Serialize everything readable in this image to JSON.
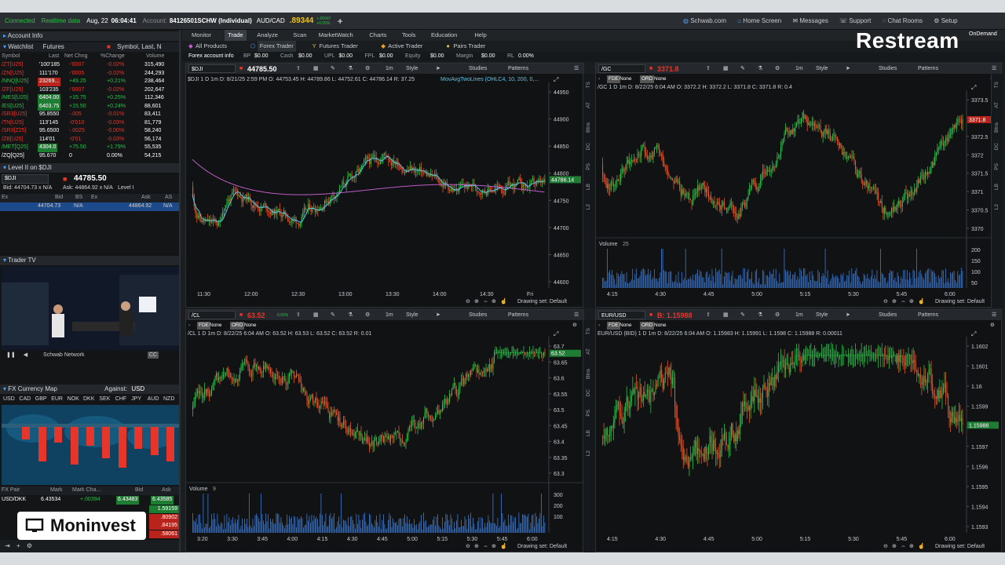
{
  "status": {
    "connection": "Connected",
    "realtime": "Realtime data",
    "date": "Aug, 22",
    "time": "06:04:41",
    "account_label": "Account:",
    "account": "84126501SCHW (Individual)",
    "pair": "AUD/CAD",
    "pair_price": ".89344",
    "pair_chg_top": "+.00047",
    "pair_chg_bot": "+0.05%"
  },
  "top_links": [
    "Schwab.com",
    "Home Screen",
    "Messages",
    "Support",
    "Chat Rooms",
    "Setup"
  ],
  "nav_tabs": [
    "Monitor",
    "Trade",
    "Analyze",
    "Scan",
    "MarketWatch",
    "Charts",
    "Tools",
    "Education",
    "Help"
  ],
  "sub_tabs": [
    "All Products",
    "Forex Trader",
    "Futures Trader",
    "Active Trader",
    "Pairs Trader"
  ],
  "forex_bar": {
    "label": "Forex account info",
    "items": [
      [
        "BP",
        "$0.00"
      ],
      [
        "Cash",
        "$0.00"
      ],
      [
        "UPL",
        "$0.00"
      ],
      [
        "FPL",
        "$0.00"
      ],
      [
        "Equity",
        "$0.00"
      ],
      [
        "Margin",
        "$0.00"
      ],
      [
        "RL",
        "0.00%"
      ]
    ]
  },
  "left": {
    "account_info": "Account Info",
    "watchlist": "Watchlist",
    "watchlist_name": "Futures",
    "symbol_search": "Symbol, Last, N",
    "wl_headers": [
      "Symbol",
      "Last",
      "Net Chng",
      "%Change",
      "Volume"
    ],
    "wl_rows": [
      [
        "/ZT[U25]",
        "'100'185",
        "-'0007",
        "-0.02%",
        "315,490"
      ],
      [
        "/ZN[U25]",
        "111'170",
        "-'0005",
        "-0.02%",
        "244,293"
      ],
      [
        "/NNQ[U25]",
        "23269...",
        "+49.25",
        "+0.21%",
        "238,464"
      ],
      [
        "/ZF[U25]",
        "103'235",
        "-'0007",
        "-0.02%",
        "202,647"
      ],
      [
        "/MES[U25]",
        "6404.00",
        "+15.75",
        "+0.25%",
        "112,346"
      ],
      [
        "/ES[U25]",
        "6403.75",
        "+15.50",
        "+0.24%",
        "88,601"
      ],
      [
        "/SR3[U25]",
        "95.8550",
        "-.005",
        "-0.01%",
        "83,411"
      ],
      [
        "/TN[U25]",
        "113'145",
        "-0'010",
        "-0.03%",
        "81,779"
      ],
      [
        "/SR3[Z25]",
        "95.6500",
        "-.0025",
        "-0.00%",
        "58,240"
      ],
      [
        "/ZB[U25]",
        "114'01",
        "-0'01",
        "-0.03%",
        "56,174"
      ],
      [
        "/MET[Q25]",
        "4304.0",
        "+75.50",
        "+1.79%",
        "55,535"
      ],
      [
        "/ZQ[Q25]",
        "95.670",
        "0",
        "0.00%",
        "54,215"
      ]
    ],
    "level2_title": "Level II on $DJI",
    "l2_symbol": "$DJI",
    "l2_price": "44785.50",
    "l2_bid": "Bid: 44704.73 x N/A",
    "l2_ask": "Ask: 44864.92 x N/A",
    "l2_level": "Level I",
    "l2_headers": [
      "Ex",
      "Bid",
      "BS",
      "Ex",
      "Ask",
      "AS"
    ],
    "l2_row": [
      "",
      "44704.73",
      "N/A",
      "",
      "44864.92",
      "N/A"
    ],
    "trader_tv": "Trader TV",
    "tv_network": "Schwab Network",
    "tv_cc": "CC",
    "fx_map": "FX Currency Map",
    "against_label": "Against:",
    "against": "USD",
    "currencies": [
      "USD",
      "CAD",
      "GBP",
      "EUR",
      "NOK",
      "DKK",
      "SEK",
      "CHF",
      "JPY",
      "AUD",
      "NZD"
    ],
    "fx_headers": [
      "FX Pair",
      "Mark",
      "Mark Cha...",
      "Bid",
      "Ask"
    ],
    "fx_row": [
      "USD/DKK",
      "6.43534",
      "+.00394",
      "6.43483",
      "6.43585"
    ],
    "fx_side": [
      "1.59159",
      ".80902",
      ".84195",
      ".58061"
    ]
  },
  "panes": {
    "dji": {
      "symbol": "$DJI",
      "price": "44785.50",
      "info": "$DJI 1 D 1m  D: 8/21/25 2:59 PM  O: 44753.45  H: 44789.86  L: 44752.61  C: 44786.14  R: 37.25",
      "study": "MovAvgTwoLines (OHLC4, 10, 200, 0,...",
      "last_tag": "44786.14",
      "y_ticks": [
        "44950",
        "44900",
        "44850",
        "44800",
        "44750",
        "44700",
        "44650",
        "44600"
      ],
      "x_ticks": [
        "11:30",
        "12:00",
        "12:30",
        "13:00",
        "13:30",
        "14:00",
        "14:30",
        "Fri"
      ],
      "drawing_set": "Drawing set: Default"
    },
    "gc": {
      "symbol": "/GC",
      "price": "3371.8",
      "info": "/GC 1 D 1m  D: 8/22/25 6:04 AM  O: 3372.2  H: 3372.2  L: 3371.8  C: 3371.8  R: 0.4",
      "last_tag": "3371.8",
      "y_ticks": [
        "3373.5",
        "3373",
        "3372.5",
        "3372",
        "3371.5",
        "3371",
        "3370.5",
        "3370"
      ],
      "volume_label": "Volume",
      "volume_val": "25",
      "vol_ticks": [
        "200",
        "150",
        "100",
        "50"
      ],
      "x_ticks": [
        "4:15",
        "4:30",
        "4:45",
        "5:00",
        "5:15",
        "5:30",
        "5:45",
        "6:00"
      ],
      "drawing_set": "Drawing set: Default"
    },
    "cl": {
      "symbol": "/CL",
      "price": "63.52",
      "chg": "0.00%",
      "info": "/CL 1 D 1m  D: 8/22/25 6:04 AM  O: 63.52  H: 63.53  L: 63.52  C: 63.52  R: 0.01",
      "last_tag": "63.52",
      "y_ticks": [
        "63.7",
        "63.65",
        "63.6",
        "63.55",
        "63.5",
        "63.45",
        "63.4",
        "63.35",
        "63.3"
      ],
      "volume_label": "Volume",
      "volume_val": "9",
      "vol_ticks": [
        "300",
        "200",
        "100"
      ],
      "x_ticks": [
        "3:20",
        "3:30",
        "3:45",
        "4:00",
        "4:15",
        "4:30",
        "4:45",
        "5:00",
        "5:15",
        "5:30",
        "5:45",
        "6:00"
      ],
      "drawing_set": "Drawing set: Default"
    },
    "eur": {
      "symbol": "EUR/USD",
      "price": "B: 1.15988",
      "info": "EUR/USD (BID) 1 D 1m  D: 8/22/25 6:04 AM  O: 1.15983  H: 1.15991  L: 1.1598  C: 1.15988  R: 0.00011",
      "last_tag": "1.15988",
      "y_ticks": [
        "1.1602",
        "1.1601",
        "1.16",
        "1.1599",
        "1.1598",
        "1.1597",
        "1.1596",
        "1.1595",
        "1.1594",
        "1.1593"
      ],
      "x_ticks": [
        "4:15",
        "4:30",
        "4:45",
        "5:00",
        "5:15",
        "5:30",
        "5:45",
        "6:00"
      ],
      "drawing_set": "Drawing set: Default"
    }
  },
  "pane_tool": {
    "time": "1m",
    "style": "Style",
    "studies": "Studies",
    "patterns": "Patterns",
    "fde": "FDE",
    "none": "None",
    "ord": "ORD"
  },
  "vtabs": [
    "TS",
    "AT",
    "Btns",
    "DC",
    "PS",
    "LB",
    "L2"
  ],
  "overlays": {
    "restream": "Restream",
    "moninvest": "Moninvest",
    "ondemand": "OnDemand"
  },
  "colors": {
    "up": "#2fbf4a",
    "down": "#e8542a",
    "ma_fast": "#5ec8e8",
    "ma_slow": "#c05cc8",
    "volume": "#3d7bd6"
  }
}
